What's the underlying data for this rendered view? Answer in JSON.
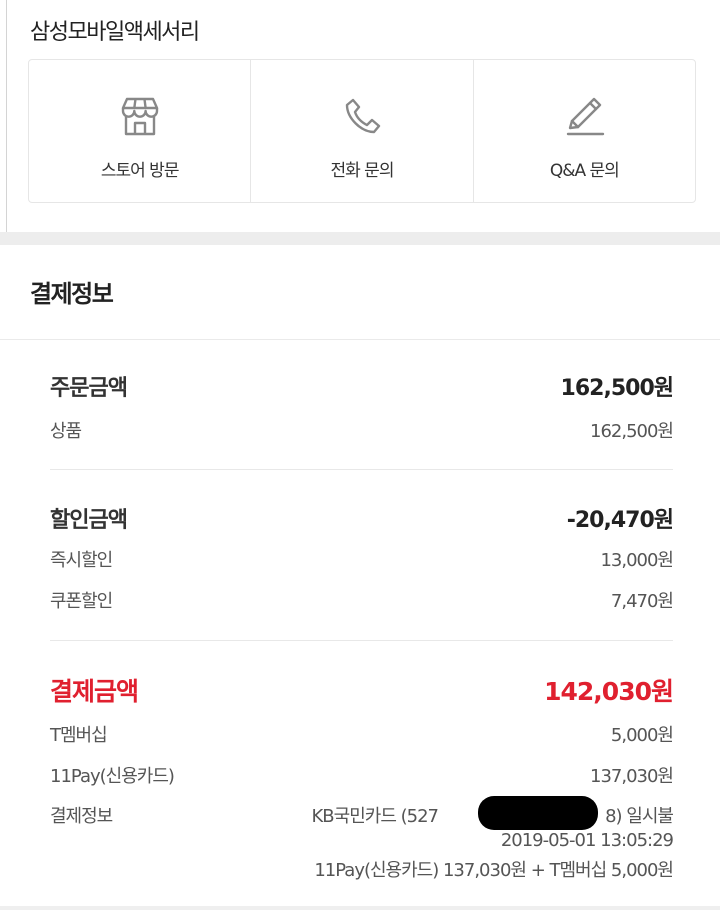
{
  "seller": {
    "name": "삼성모바일액세서리",
    "actions": [
      {
        "label": "스토어 방문",
        "icon": "store-icon"
      },
      {
        "label": "전화 문의",
        "icon": "phone-icon"
      },
      {
        "label": "Q&A 문의",
        "icon": "pencil-icon"
      }
    ]
  },
  "payment": {
    "title": "결제정보",
    "order": {
      "label": "주문금액",
      "value": "162,500원",
      "items": [
        {
          "label": "상품",
          "value": "162,500원"
        }
      ]
    },
    "discount": {
      "label": "할인금액",
      "value": "-20,470원",
      "items": [
        {
          "label": "즉시할인",
          "value": "13,000원"
        },
        {
          "label": "쿠폰할인",
          "value": "7,470원"
        }
      ]
    },
    "total": {
      "label": "결제금액",
      "value": "142,030원",
      "items": [
        {
          "label": "T멤버십",
          "value": "5,000원"
        },
        {
          "label": "11Pay(신용카드)",
          "value": "137,030원"
        }
      ]
    },
    "detail": {
      "label": "결제정보",
      "card": "KB국민카드 (527",
      "card_tail": "8) 일시불",
      "datetime": "2019-05-01 13:05:29",
      "summary": "11Pay(신용카드) 137,030원 + T멤버십 5,000원"
    }
  },
  "colors": {
    "accent": "#e0202f",
    "divider": "#e8e8e8",
    "background_gap": "#ededed"
  }
}
